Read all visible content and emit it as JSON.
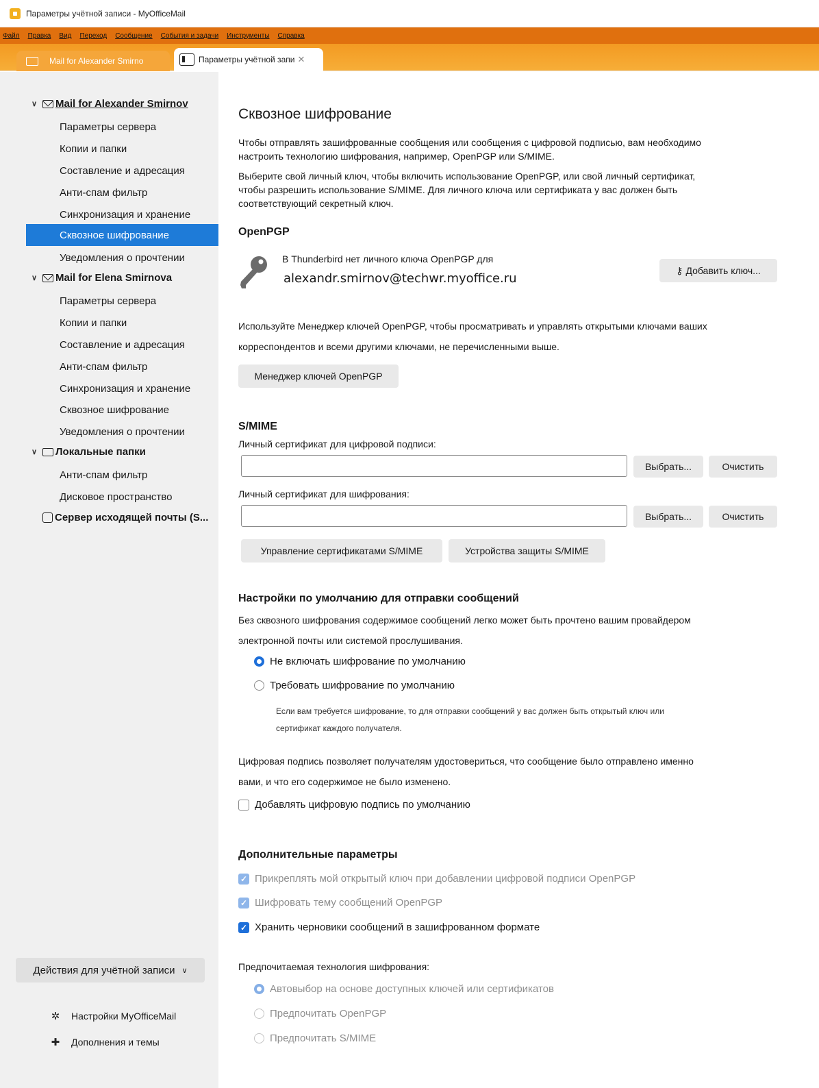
{
  "window": {
    "title": "Параметры учётной записи - MyOfficeMail"
  },
  "menu": [
    "Файл",
    "Правка",
    "Вид",
    "Переход",
    "Сообщение",
    "События и задачи",
    "Инструменты",
    "Справка"
  ],
  "tabs": {
    "mail_tab": "Mail for Alexander Smirno",
    "settings_tab": "Параметры учётной запи"
  },
  "sidebar": {
    "accounts": [
      {
        "name": "Mail for Alexander Smirnov",
        "items": [
          "Параметры сервера",
          "Копии и папки",
          "Составление и адресация",
          "Анти-спам фильтр",
          "Синхронизация и хранение",
          "Сквозное шифрование",
          "Уведомления о прочтении"
        ]
      },
      {
        "name": "Mail for Elena Smirnova",
        "items": [
          "Параметры сервера",
          "Копии и папки",
          "Составление и адресация",
          "Анти-спам фильтр",
          "Синхронизация и хранение",
          "Сквозное шифрование",
          "Уведомления о прочтении"
        ]
      },
      {
        "name": "Локальные папки",
        "items": [
          "Анти-спам фильтр",
          "Дисковое пространство"
        ]
      }
    ],
    "outgoing_server": "Сервер исходящей почты (S...",
    "account_actions": "Действия для учётной записи",
    "settings_link": "Настройки MyOfficeMail",
    "addons_link": "Дополнения и темы"
  },
  "main": {
    "title": "Сквозное шифрование",
    "intro1_line1": "Чтобы отправлять зашифрованные сообщения или сообщения с цифровой подписью, вам необходимо",
    "intro1_line2": "настроить технологию шифрования, например, OpenPGP или S/MIME.",
    "intro2_line1": "Выберите свой личный ключ, чтобы включить использование OpenPGP, или свой личный сертификат,",
    "intro2_line2": "чтобы разрешить использование S/MIME. Для личного ключа или сертификата у вас должен быть",
    "intro2_line3": "соответствующий секретный ключ.",
    "openpgp": {
      "heading": "OpenPGP",
      "no_key_text": "В Thunderbird нет личного ключа OpenPGP для",
      "email": "alexandr.smirnov@techwr.myoffice.ru",
      "add_key_button": "Добавить ключ...",
      "manager_desc_line1": "Используйте Менеджер ключей OpenPGP, чтобы просматривать и управлять открытыми ключами ваших",
      "manager_desc_line2": "корреспондентов и всеми другими ключами, не перечисленными выше.",
      "manager_button": "Менеджер ключей OpenPGP"
    },
    "smime": {
      "heading": "S/MIME",
      "sign_cert_label": "Личный сертификат для цифровой подписи:",
      "sign_cert_value": "",
      "encrypt_cert_label": "Личный сертификат для шифрования:",
      "encrypt_cert_value": "",
      "select_button": "Выбрать...",
      "clear_button": "Очистить",
      "manage_certs_button": "Управление сертификатами S/MIME",
      "security_devices_button": "Устройства защиты S/MIME"
    },
    "defaults": {
      "heading": "Настройки по умолчанию для отправки сообщений",
      "desc_line1": "Без сквозного шифрования содержимое сообщений легко может быть прочтено вашим провайдером",
      "desc_line2": "электронной почты или системой прослушивания.",
      "radio_no_encrypt": "Не включать шифрование по умолчанию",
      "radio_require_encrypt": "Требовать шифрование по умолчанию",
      "require_note_line1": "Если вам требуется шифрование, то для отправки сообщений у вас должен быть открытый ключ или",
      "require_note_line2": "сертификат каждого получателя.",
      "signature_desc_line1": "Цифровая подпись позволяет получателям удостовериться, что сообщение было отправлено именно",
      "signature_desc_line2": "вами, и что его содержимое не было изменено.",
      "add_signature_checkbox": "Добавлять цифровую подпись по умолчанию"
    },
    "advanced": {
      "heading": "Дополнительные параметры",
      "attach_key_checkbox": "Прикреплять мой открытый ключ при добавлении цифровой подписи OpenPGP",
      "encrypt_subject_checkbox": "Шифровать тему сообщений OpenPGP",
      "store_drafts_checkbox": "Хранить черновики сообщений в зашифрованном формате",
      "preferred_tech_label": "Предпочитаемая технология шифрования:",
      "radio_auto": "Автовыбор на основе доступных ключей или сертификатов",
      "radio_prefer_openpgp": "Предпочитать OpenPGP",
      "radio_prefer_smime": "Предпочитать S/MIME"
    }
  },
  "colors": {
    "accent": "#1e7bd8",
    "menubar": "#e0700e",
    "tabstrip": "#f39a22"
  }
}
